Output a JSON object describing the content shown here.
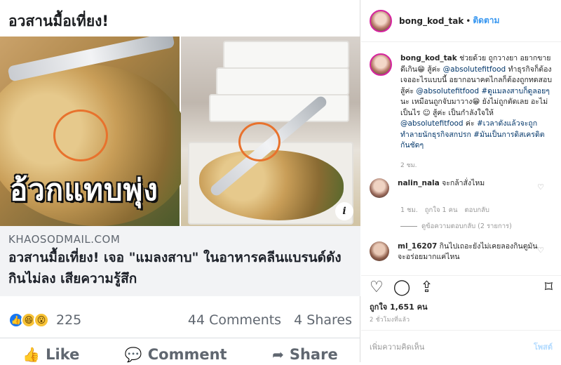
{
  "fb": {
    "header": "อวสานมื้อเที่ยง!",
    "image_overlay": "อ้วกแทบพุ่ง",
    "info_icon": "i",
    "link_domain": "KHAOSODMAIL.COM",
    "link_title": "อวสานมื้อเที่ยง! เจอ \"แมลงสาบ\" ในอาหารคลีนแบรนด์ดัง กินไม่ลง เสียความรู้สึก",
    "reactions": {
      "icons": [
        "like",
        "haha",
        "wow"
      ],
      "count": "225"
    },
    "comments": "44 Comments",
    "shares": "4 Shares",
    "actions": {
      "like": "Like",
      "comment": "Comment",
      "share": "Share"
    }
  },
  "ig": {
    "username": "bong_kod_tak",
    "dot": "•",
    "follow": "ติดตาม",
    "caption_user": "bong_kod_tak",
    "caption_parts": [
      " ช่วยด้วย ถูกวางยา อยากขายดีเกิน😁 สู้ค่ะ ",
      "@absolutefitfood",
      " ทำธุรกิจก็ต้องเจออะไรแบบนี้ อยากอนาคตไกลก็ต้องถูกทดสอบ สู้ค่ะ ",
      "@absolutefitfood",
      " ",
      "#ดูแมลงสาบก็ดูลอยๆ",
      " นะ เหมือนถูกจับมาวาง😁 ยังไม่ถูกตัดเลย อะไม่เป็นไร ☺ สู้ค่ะ เป็นกำลังใจให้ ",
      "@absolutefitfood",
      " ค่ะ ",
      "#เวลาดังแล้วจะถูกทำลายนักธุรกิจสกปรก",
      " ",
      "#มันเป็นการดิสเครดิตกันชัดๆ"
    ],
    "caption_time": "2 ชม.",
    "comments": [
      {
        "user": "nalin_nala",
        "text": " จะกล้าสั่งไหม",
        "meta": {
          "time": "1 ชม.",
          "likes": "ถูกใจ 1 คน",
          "reply": "ตอบกลับ"
        },
        "replies": "ดูข้อความตอบกลับ (2 รายการ)"
      },
      {
        "user": "ml_16207",
        "text": " กินไปเถอะยังไม่เคยลองกินตูมันจะอร่อยมากแค่ไหน"
      }
    ],
    "likes": "ถูกใจ 1,651 คน",
    "ago": "2 ชั่วโมงที่แล้ว",
    "comment_placeholder": "เพิ่มความคิดเห็น",
    "post_label": "โพสต์"
  }
}
